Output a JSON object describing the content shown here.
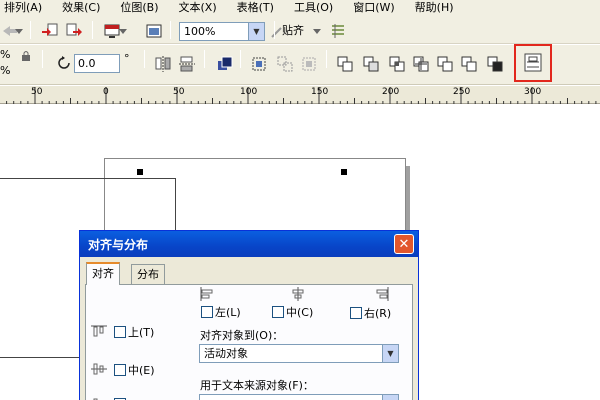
{
  "menu": [
    "排列(A)",
    "效果(C)",
    "位图(B)",
    "文本(X)",
    "表格(T)",
    "工具(O)",
    "窗口(W)",
    "帮助(H)"
  ],
  "toolbar": {
    "zoom_value": "100%",
    "snap_label": "贴齐"
  },
  "property_bar": {
    "percent_top": "%",
    "percent_bottom": "%",
    "rotation_value": "0.0",
    "degree_symbol": "°"
  },
  "ruler": {
    "labels": [
      "50",
      "0",
      "50",
      "100",
      "150",
      "200",
      "250",
      "300"
    ]
  },
  "dialog": {
    "title": "对齐与分布",
    "close_label": "✕",
    "tabs": [
      "对齐",
      "分布"
    ],
    "checks": {
      "left": "左(L)",
      "center_h": "中(C)",
      "right": "右(R)",
      "top": "上(T)",
      "center_v": "中(E)"
    },
    "align_to_label": "对齐对象到(O)：",
    "align_to_value": "活动对象",
    "text_source_label": "用于文本来源对象(F)："
  },
  "colors": {
    "highlight": "#e2271d",
    "titlebar": "#0845c8",
    "chrome": "#f1efe2"
  },
  "icons": [
    "undo-arrow-icon",
    "import-icon",
    "export-icon",
    "app-launcher-icon",
    "welcome-screen-icon",
    "snap-options-icon",
    "rotate-icon",
    "mirror-horizontal-icon",
    "mirror-vertical-icon",
    "to-front-icon",
    "group-icon",
    "ungroup-icon",
    "ungroup-all-icon",
    "weld-icon",
    "trim-icon",
    "intersect-icon",
    "simplify-icon",
    "front-minus-back-icon",
    "back-minus-front-icon",
    "boundary-icon",
    "align-distribute-icon"
  ]
}
